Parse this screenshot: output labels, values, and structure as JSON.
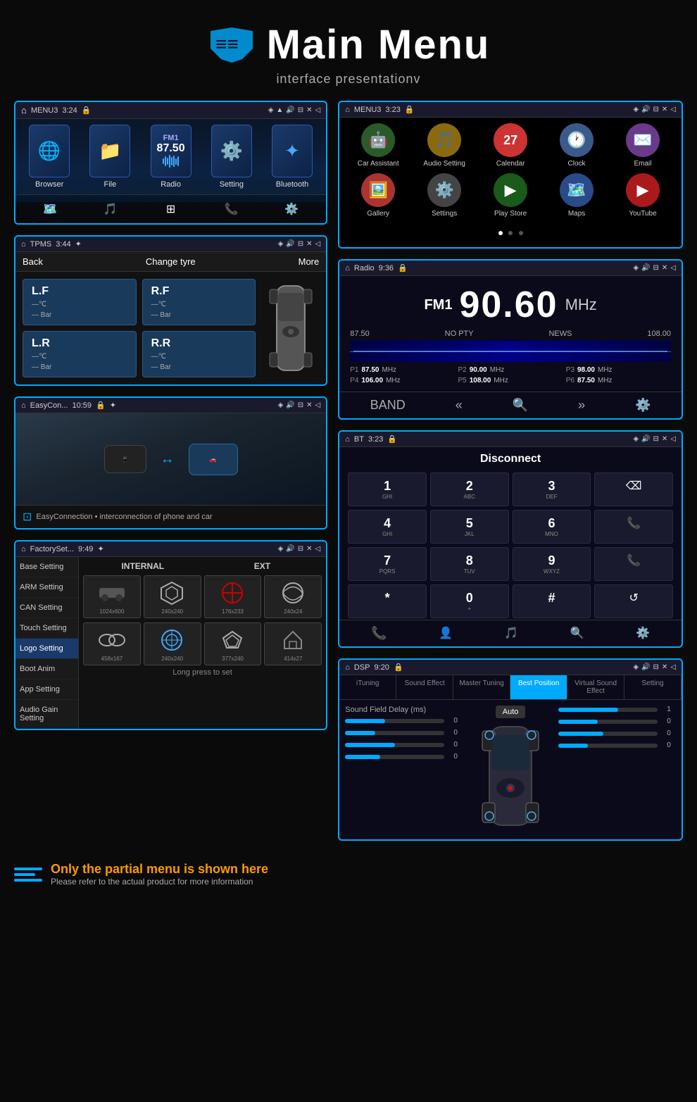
{
  "header": {
    "title": "Main Menu",
    "subtitle": "interface presentationv"
  },
  "screens": {
    "mainMenu": {
      "statusBar": {
        "app": "MENU3",
        "time": "3:24"
      },
      "apps": [
        {
          "label": "Browser",
          "icon": "🌐",
          "color": "#1a3a6b"
        },
        {
          "label": "File",
          "icon": "📁",
          "color": "#1a3a6b"
        },
        {
          "label": "Radio",
          "icon": "📻",
          "color": "#1a3a6b",
          "freq": "FM1",
          "num": "87.50"
        },
        {
          "label": "Setting",
          "icon": "⚙️",
          "color": "#1a3a6b"
        },
        {
          "label": "Bluetooth",
          "icon": "🔷",
          "color": "#1a3a6b"
        }
      ],
      "taskbar": [
        "🗺️",
        "🎵",
        "⊞",
        "📞",
        "⚙️"
      ]
    },
    "appGrid": {
      "statusBar": {
        "app": "MENU3",
        "time": "3:23"
      },
      "row1": [
        {
          "label": "Car Assistant",
          "icon": "🤖",
          "bg": "#4a7a4a"
        },
        {
          "label": "Audio Setting",
          "icon": "🎵",
          "bg": "#c0a030"
        },
        {
          "label": "Calendar",
          "icon": "📅",
          "bg": "#cc4444",
          "num": "27"
        },
        {
          "label": "Clock",
          "icon": "🕐",
          "bg": "#4a6aaa"
        },
        {
          "label": "Email",
          "icon": "✉️",
          "bg": "#8a4aaa"
        }
      ],
      "row2": [
        {
          "label": "Gallery",
          "icon": "🖼️",
          "bg": "#cc5555"
        },
        {
          "label": "Settings",
          "icon": "⚙️",
          "bg": "#555"
        },
        {
          "label": "Play Store",
          "icon": "▶",
          "bg": "#4a8a4a"
        },
        {
          "label": "Maps",
          "icon": "🗺️",
          "bg": "#4a7aaa"
        },
        {
          "label": "YouTube",
          "icon": "▶",
          "bg": "#cc3333"
        }
      ]
    },
    "tpms": {
      "statusBar": {
        "app": "TPMS",
        "time": "3:44"
      },
      "back": "Back",
      "title": "Change tyre",
      "more": "More",
      "cells": [
        {
          "pos": "L.F",
          "temp": "—℃",
          "bar": "— Bar"
        },
        {
          "pos": "R.F",
          "temp": "—℃",
          "bar": "— Bar"
        },
        {
          "pos": "L.R",
          "temp": "—℃",
          "bar": "— Bar"
        },
        {
          "pos": "R.R",
          "temp": "—℃",
          "bar": "— Bar"
        }
      ]
    },
    "radio": {
      "statusBar": {
        "app": "Radio",
        "time": "9:36"
      },
      "fmLabel": "FM1",
      "frequency": "90.60",
      "unit": "MHz",
      "minFreq": "87.50",
      "maxFreq": "108.00",
      "nopty": "NO PTY",
      "news": "NEWS",
      "presets": [
        {
          "label": "P1",
          "freq": "87.50",
          "unit": "MHz"
        },
        {
          "label": "P2",
          "freq": "90.00",
          "unit": "MHz"
        },
        {
          "label": "P3",
          "freq": "98.00",
          "unit": "MHz"
        },
        {
          "label": "P4",
          "freq": "106.00",
          "unit": "MHz"
        },
        {
          "label": "P5",
          "freq": "108.00",
          "unit": "MHz"
        },
        {
          "label": "P6",
          "freq": "87.50",
          "unit": "MHz"
        }
      ]
    },
    "bluetooth": {
      "statusBar": {
        "app": "BT",
        "time": "3:23"
      },
      "title": "Disconnect",
      "keys": [
        {
          "num": "1",
          "sub": "GHI"
        },
        {
          "num": "2",
          "sub": "ABC"
        },
        {
          "num": "3",
          "sub": "DEF"
        },
        {
          "special": "⌫"
        },
        {
          "num": "4",
          "sub": "GHI"
        },
        {
          "num": "5",
          "sub": "JKL"
        },
        {
          "num": "6",
          "sub": "MNO"
        },
        {
          "special": "📞",
          "class": "green"
        },
        {
          "num": "7",
          "sub": "PQRS"
        },
        {
          "num": "8",
          "sub": "TUV"
        },
        {
          "num": "9",
          "sub": "WXYZ"
        },
        {
          "special": "📞",
          "class": "red"
        },
        {
          "num": "*",
          "sub": ""
        },
        {
          "num": "0",
          "sub": "+"
        },
        {
          "num": "#",
          "sub": ""
        },
        {
          "special": "↺"
        }
      ]
    },
    "easyConnection": {
      "statusBar": {
        "app": "EasyCon...",
        "time": "10:59"
      },
      "description": "EasyConnection • interconnection of phone and car"
    },
    "factorySettings": {
      "statusBar": {
        "app": "FactorySet...",
        "time": "9:49"
      },
      "menu": [
        "Base Setting",
        "ARM Setting",
        "CAN Setting",
        "Touch Setting",
        "Logo Setting",
        "Boot Anim",
        "App Setting",
        "Audio Gain Setting"
      ],
      "activeMenu": "Logo Setting",
      "sections": {
        "internal": "INTERNAL",
        "ext": "EXT"
      },
      "logos": [
        {
          "label": "🐻",
          "size": "1024x600"
        },
        {
          "label": "🛡️",
          "size": "240x240"
        },
        {
          "label": "🏎️",
          "size": "176x233"
        },
        {
          "label": "⭐",
          "size": "240x24"
        }
      ],
      "logos2": [
        {
          "label": "🔵",
          "size": "458x167"
        },
        {
          "label": "⭕",
          "size": "240x240"
        },
        {
          "label": "⭐",
          "size": "377x240"
        },
        {
          "label": "🔷",
          "size": "414x27"
        }
      ],
      "note": "Long press to set"
    },
    "dsp": {
      "statusBar": {
        "app": "DSP",
        "time": "9:20"
      },
      "tabs": [
        "iTuning",
        "Sound Effect",
        "Master Tuning",
        "Best Position",
        "Virtual Sound Effect",
        "Setting"
      ],
      "activeTab": "Best Position",
      "delayLabel": "Sound Field Delay (ms)",
      "autoBtn": "Auto",
      "sliders": [
        {
          "val": "0"
        },
        {
          "val": "0"
        },
        {
          "val": "0"
        },
        {
          "val": "0"
        }
      ],
      "rightSliders": [
        {
          "val": "1"
        },
        {
          "val": "0"
        },
        {
          "val": "0"
        }
      ]
    }
  },
  "footer": {
    "mainText": "Only the partial menu is shown here",
    "subText": "Please refer to the actual product for more information"
  }
}
